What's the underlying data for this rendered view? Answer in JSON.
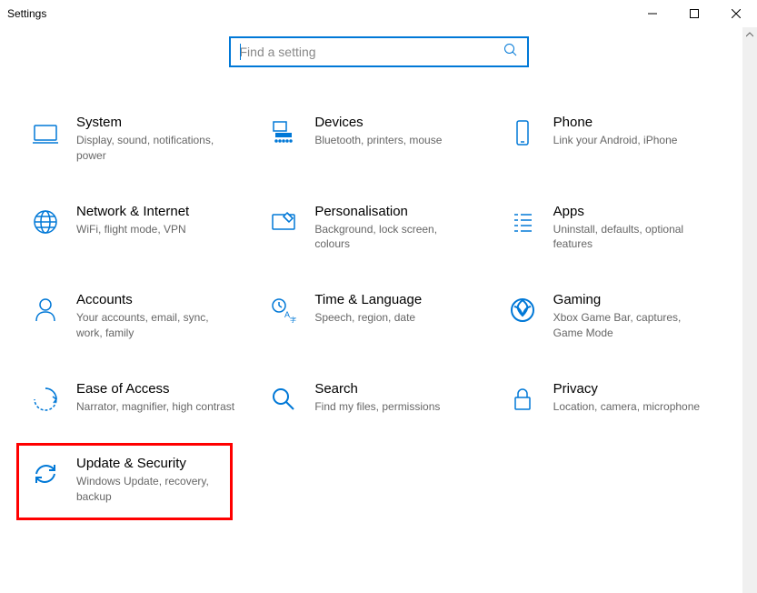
{
  "window": {
    "title": "Settings"
  },
  "search": {
    "placeholder": "Find a setting"
  },
  "tiles": [
    {
      "id": "system",
      "title": "System",
      "desc": "Display, sound, notifications, power"
    },
    {
      "id": "devices",
      "title": "Devices",
      "desc": "Bluetooth, printers, mouse"
    },
    {
      "id": "phone",
      "title": "Phone",
      "desc": "Link your Android, iPhone"
    },
    {
      "id": "network",
      "title": "Network & Internet",
      "desc": "WiFi, flight mode, VPN"
    },
    {
      "id": "personalisation",
      "title": "Personalisation",
      "desc": "Background, lock screen, colours"
    },
    {
      "id": "apps",
      "title": "Apps",
      "desc": "Uninstall, defaults, optional features"
    },
    {
      "id": "accounts",
      "title": "Accounts",
      "desc": "Your accounts, email, sync, work, family"
    },
    {
      "id": "time",
      "title": "Time & Language",
      "desc": "Speech, region, date"
    },
    {
      "id": "gaming",
      "title": "Gaming",
      "desc": "Xbox Game Bar, captures, Game Mode"
    },
    {
      "id": "ease",
      "title": "Ease of Access",
      "desc": "Narrator, magnifier, high contrast"
    },
    {
      "id": "search",
      "title": "Search",
      "desc": "Find my files, permissions"
    },
    {
      "id": "privacy",
      "title": "Privacy",
      "desc": "Location, camera, microphone"
    },
    {
      "id": "update",
      "title": "Update & Security",
      "desc": "Windows Update, recovery, backup"
    }
  ],
  "highlight_index": 12
}
